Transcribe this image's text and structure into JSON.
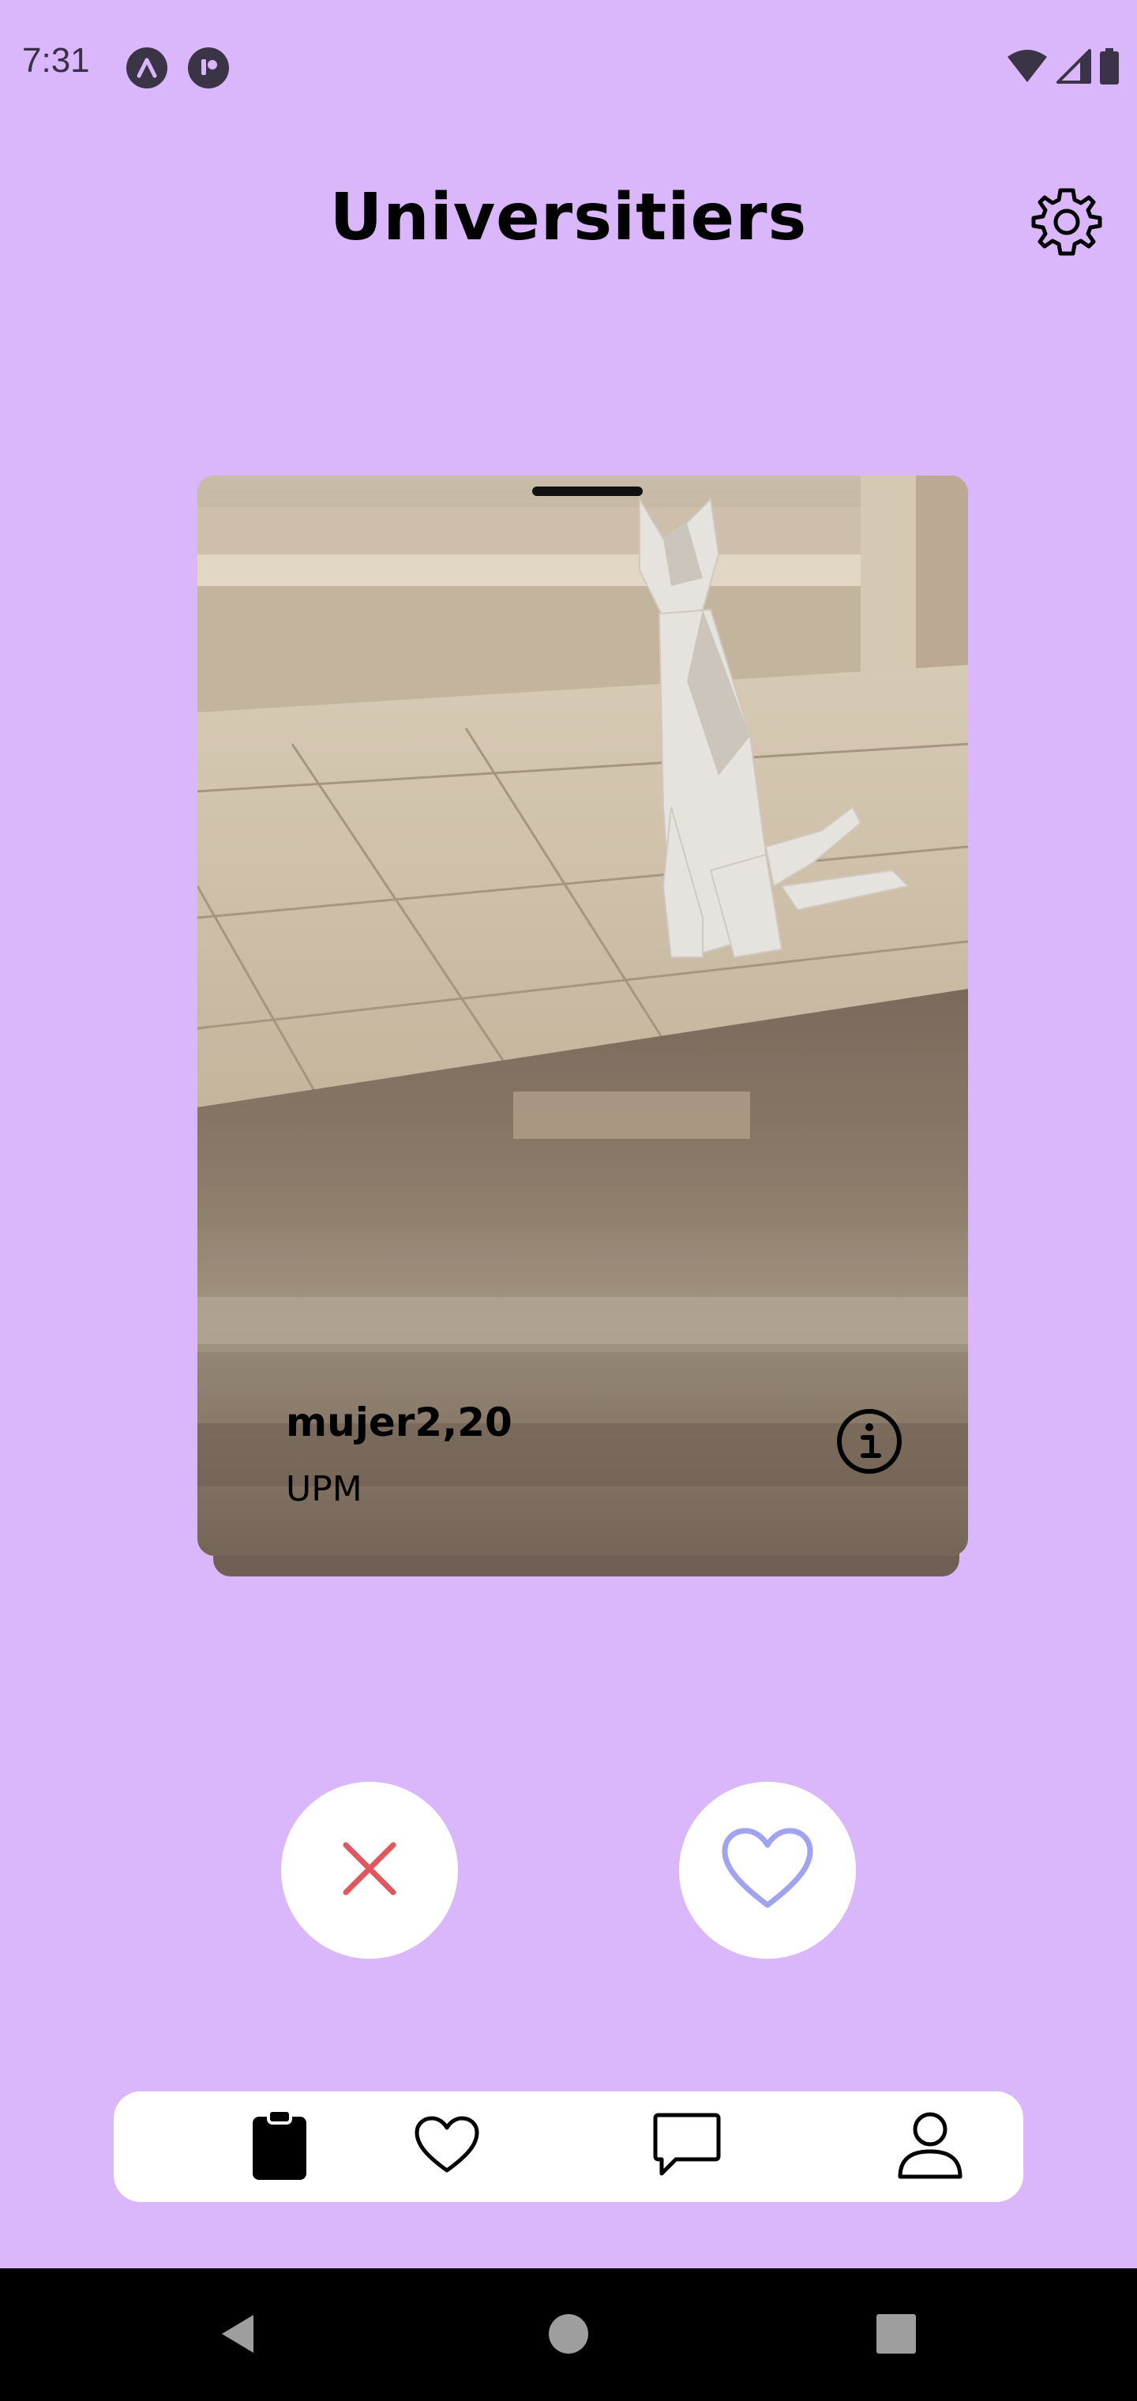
{
  "status_bar": {
    "time": "7:31",
    "icons": [
      "app-a-icon",
      "app-record-icon",
      "wifi-icon",
      "cell-signal-icon",
      "battery-icon"
    ]
  },
  "header": {
    "title": "Universitiers",
    "settings_icon": "gear-icon"
  },
  "card": {
    "name_age": "mujer2,20",
    "university": "UPM",
    "info_icon": "info-icon"
  },
  "actions": {
    "dislike_icon": "close-icon",
    "like_icon": "heart-icon"
  },
  "bottom_nav": {
    "items": [
      {
        "id": "cards",
        "icon": "clipboard-icon",
        "active": true
      },
      {
        "id": "likes",
        "icon": "heart-icon",
        "active": false
      },
      {
        "id": "chat",
        "icon": "chat-bubble-icon",
        "active": false
      },
      {
        "id": "profile",
        "icon": "person-icon",
        "active": false
      }
    ]
  },
  "system_nav": {
    "icons": [
      "back-icon",
      "home-icon",
      "recents-icon"
    ]
  },
  "colors": {
    "background": "#dab6fa",
    "dislike": "#e0575d",
    "like": "#9fa3f0",
    "nav_background": "#ffffff"
  }
}
